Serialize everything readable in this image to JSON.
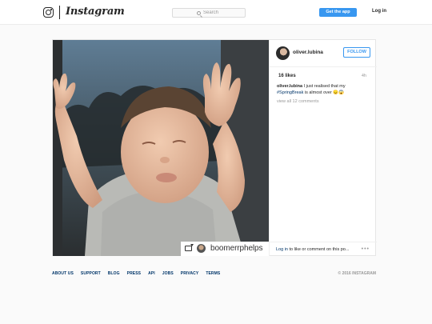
{
  "header": {
    "brand": "Instagram",
    "search_placeholder": "Search",
    "get_app_label": "Get the app",
    "login_label": "Log in"
  },
  "post": {
    "username": "oliver.lubina",
    "follow_label": "FOLLOW",
    "likes": "16 likes",
    "age": "4h",
    "caption_user": "oliver.lubina",
    "caption_text_1": " I just realised that my ",
    "caption_hashtag": "#SpringBreak",
    "caption_text_2": " is almost over 😞😱",
    "view_all": "view all 12 comments",
    "tagged_user": "boomerrphelps",
    "footer_login": "Log in",
    "footer_text": " to like or comment on this po..."
  },
  "footer": {
    "links": [
      "ABOUT US",
      "SUPPORT",
      "BLOG",
      "PRESS",
      "API",
      "JOBS",
      "PRIVACY",
      "TERMS"
    ],
    "copyright": "© 2016 INSTAGRAM"
  },
  "colors": {
    "accent": "#3897f0",
    "link": "#003569",
    "muted": "#999999"
  }
}
